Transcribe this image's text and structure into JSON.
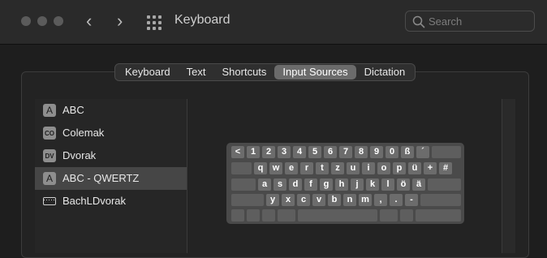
{
  "window": {
    "title": "Keyboard",
    "back_glyph": "‹",
    "forward_glyph": "›"
  },
  "search": {
    "placeholder": "Search",
    "value": ""
  },
  "tabs": [
    {
      "label": "Keyboard"
    },
    {
      "label": "Text"
    },
    {
      "label": "Shortcuts"
    },
    {
      "label": "Input Sources",
      "selected": true
    },
    {
      "label": "Dictation"
    }
  ],
  "sources": [
    {
      "badge": "A",
      "label": "ABC",
      "icon": "a-badge-icon"
    },
    {
      "badge": "CO",
      "label": "Colemak",
      "icon": "colemak-badge-icon"
    },
    {
      "badge": "DV",
      "label": "Dvorak",
      "icon": "dvorak-badge-icon"
    },
    {
      "badge": "A",
      "label": "ABC - QWERTZ",
      "icon": "a-badge-icon",
      "selected": true
    },
    {
      "badge": "",
      "label": "BachLDvorak",
      "icon": "keyboard-icon"
    }
  ],
  "keyboard": {
    "rows": [
      [
        "<",
        "1",
        "2",
        "3",
        "4",
        "5",
        "6",
        "7",
        "8",
        "9",
        "0",
        "ß",
        "´",
        ""
      ],
      [
        "",
        "q",
        "w",
        "e",
        "r",
        "t",
        "z",
        "u",
        "i",
        "o",
        "p",
        "ü",
        "+",
        "#"
      ],
      [
        "",
        "a",
        "s",
        "d",
        "f",
        "g",
        "h",
        "j",
        "k",
        "l",
        "ö",
        "ä",
        ""
      ],
      [
        "",
        "y",
        "x",
        "c",
        "v",
        "b",
        "n",
        "m",
        ",",
        ".",
        "-",
        ""
      ],
      [
        "",
        "",
        "",
        "",
        "",
        "",
        "",
        ""
      ]
    ]
  }
}
